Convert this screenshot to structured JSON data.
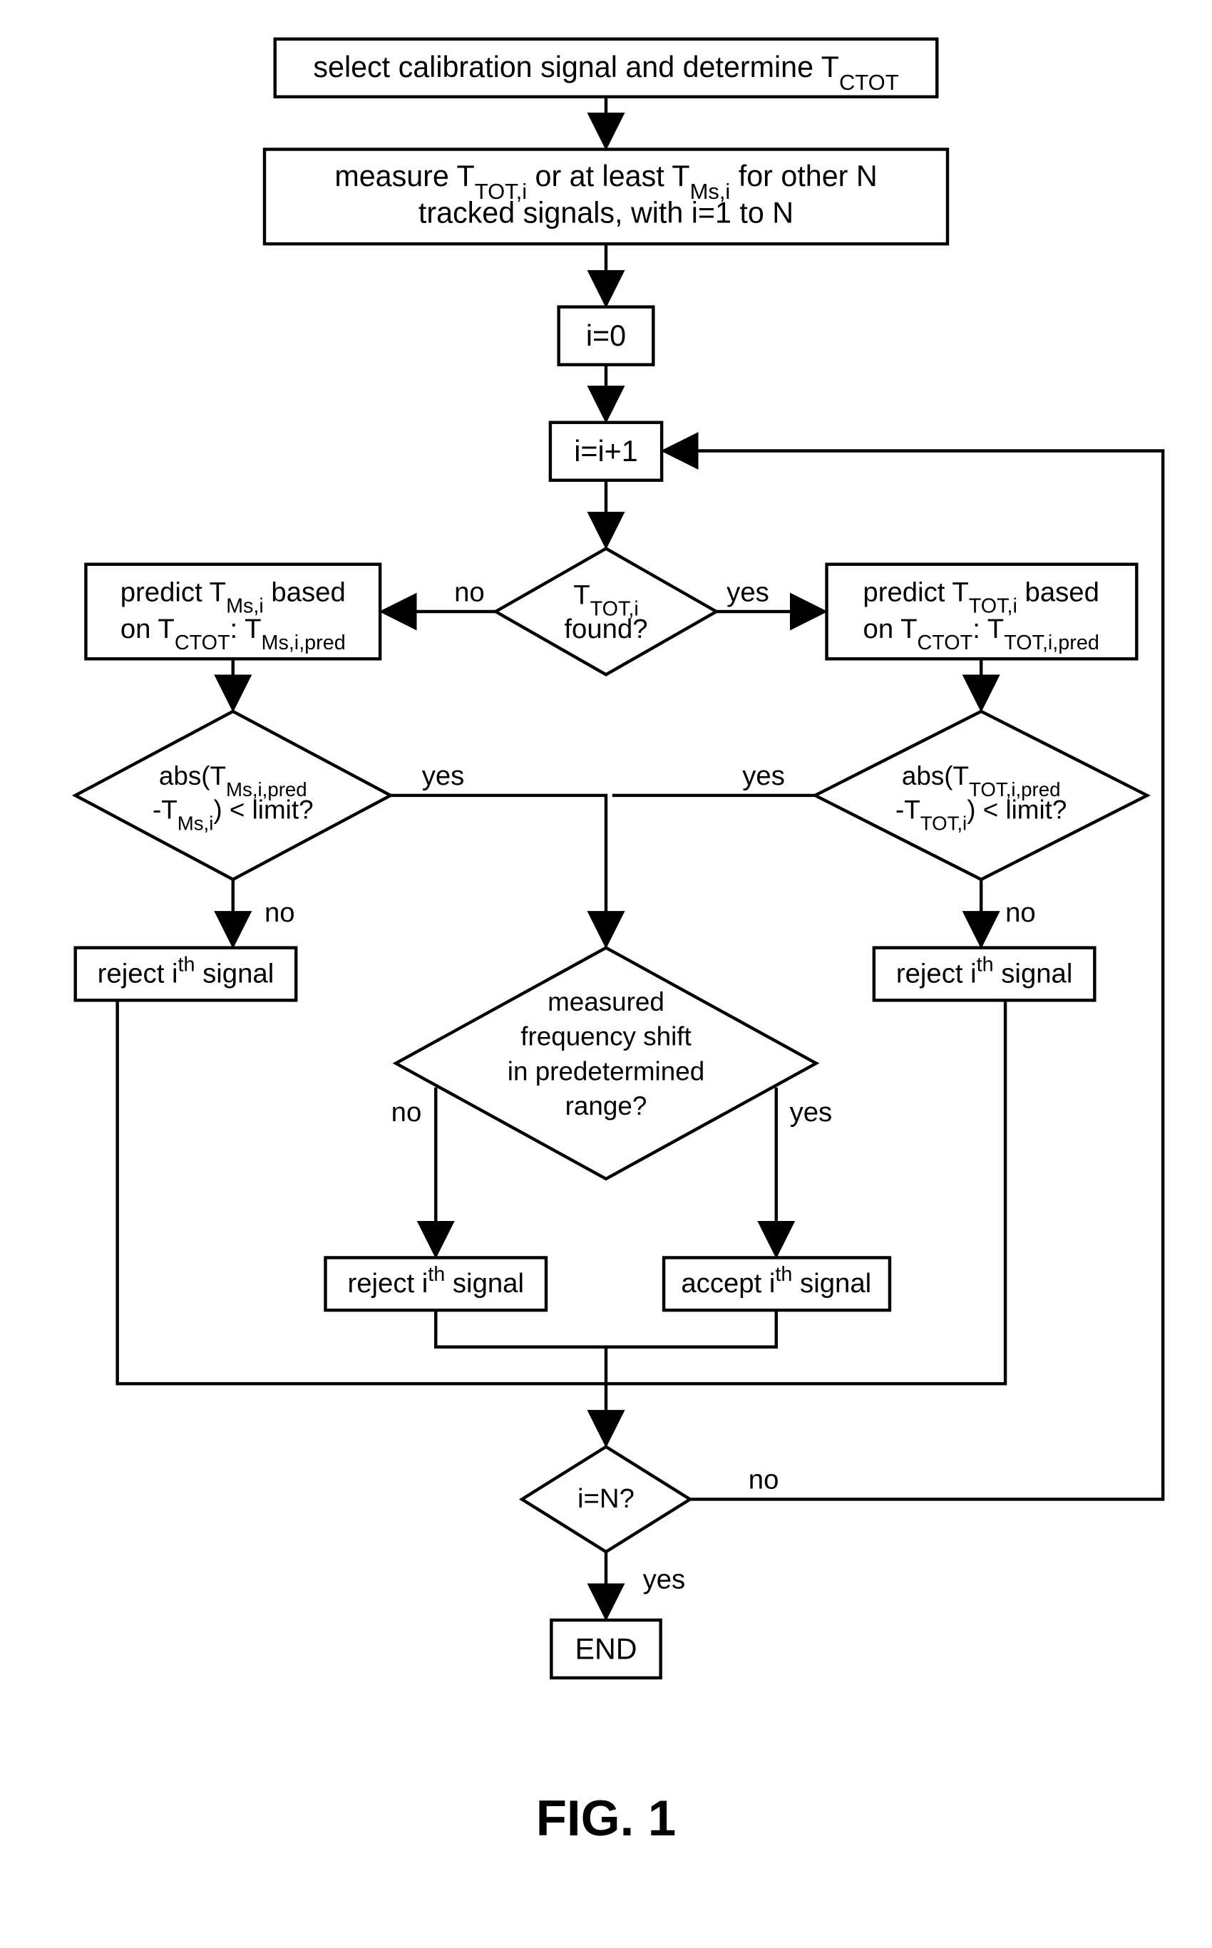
{
  "figure_label": "FIG. 1",
  "nodes": {
    "select_cal": "select calibration signal and determine T_CTOT",
    "measure_l1": "measure T_TOT,i or at least T_Ms,i for other N",
    "measure_l2": "tracked signals, with i=1 to N",
    "init": "i=0",
    "inc": "i=i+1",
    "found_l1": "T_TOT,i",
    "found_l2": "found?",
    "predict_ms_l1": "predict T_Ms,i based",
    "predict_ms_l2": "on T_CTOT: T_Ms,i,pred",
    "predict_tot_l1": "predict T_TOT,i based",
    "predict_tot_l2": "on T_CTOT: T_TOT,i,pred",
    "check_ms_l1": "abs(T_Ms,i,pred",
    "check_ms_l2": "-T_Ms,i) < limit?",
    "check_tot_l1": "abs(T_TOT,i,pred",
    "check_tot_l2": "-T_TOT,i) < limit?",
    "reject_l": "reject i^th signal",
    "reject_r": "reject i^th signal",
    "freq_l1": "measured",
    "freq_l2": "frequency shift",
    "freq_l3": "in predetermined",
    "freq_l4": "range?",
    "reject_c": "reject i^th signal",
    "accept_c": "accept i^th signal",
    "isN": "i=N?",
    "end": "END"
  },
  "labels": {
    "yes": "yes",
    "no": "no"
  }
}
